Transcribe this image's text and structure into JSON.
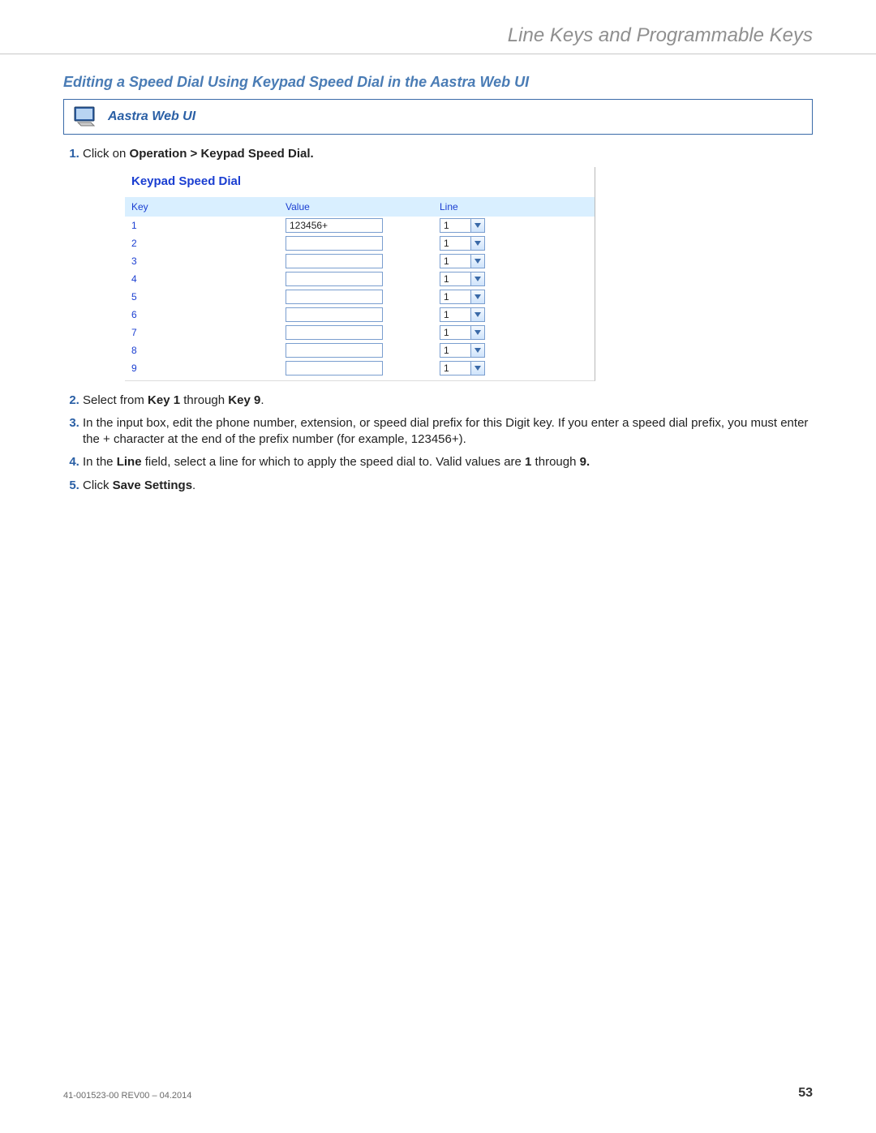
{
  "header": {
    "title": "Line Keys and Programmable Keys"
  },
  "section": {
    "heading": "Editing a Speed Dial Using Keypad Speed Dial in the Aastra Web UI",
    "callout_title": "Aastra Web UI"
  },
  "steps": {
    "s1_prefix": "Click on ",
    "s1_bold": "Operation > Keypad Speed Dial.",
    "s2_a": "Select from ",
    "s2_b1": "Key 1",
    "s2_b": " through ",
    "s2_b2": "Key 9",
    "s2_c": ".",
    "s3": "In the input box, edit the phone number, extension, or speed dial prefix for this Digit key. If you enter a speed dial prefix, you must enter the + character at the end of the prefix number (for example, 123456+).",
    "s4_a": "In the ",
    "s4_b1": "Line",
    "s4_b": " field, select a line for which to apply the speed dial to. Valid values are ",
    "s4_b2": "1",
    "s4_c": " through ",
    "s4_b3": "9.",
    "s5_a": "Click ",
    "s5_b": "Save Settings",
    "s5_c": "."
  },
  "screenshot": {
    "title": "Keypad Speed Dial",
    "headers": {
      "key": "Key",
      "value": "Value",
      "line": "Line"
    },
    "rows": [
      {
        "key": "1",
        "value": "123456+",
        "line": "1"
      },
      {
        "key": "2",
        "value": "",
        "line": "1"
      },
      {
        "key": "3",
        "value": "",
        "line": "1"
      },
      {
        "key": "4",
        "value": "",
        "line": "1"
      },
      {
        "key": "5",
        "value": "",
        "line": "1"
      },
      {
        "key": "6",
        "value": "",
        "line": "1"
      },
      {
        "key": "7",
        "value": "",
        "line": "1"
      },
      {
        "key": "8",
        "value": "",
        "line": "1"
      },
      {
        "key": "9",
        "value": "",
        "line": "1"
      }
    ]
  },
  "footer": {
    "docref": "41-001523-00 REV00 – 04.2014",
    "page": "53"
  }
}
